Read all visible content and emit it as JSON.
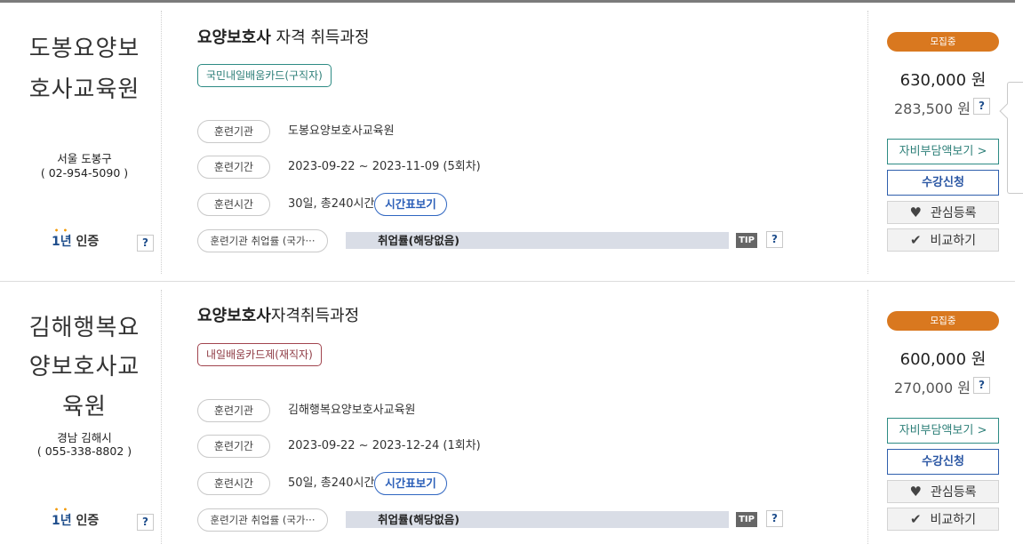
{
  "courses": [
    {
      "institution": {
        "name_line1": "도봉요양보",
        "name_line2": "호사교육원",
        "name_line3": "",
        "region": "서울 도봉구",
        "phone": "( 02-954-5090 )"
      },
      "certification": {
        "years": "1년",
        "label": "인증"
      },
      "title": {
        "bold": "요양보호사",
        "rest": " 자격 취득과정"
      },
      "card_tag": "국민내일배움카드(구직자)",
      "rows": [
        {
          "label": "훈련기관",
          "value": "도봉요양보호사교육원"
        },
        {
          "label": "훈련기간",
          "value": "2023-09-22 ~ 2023-11-09 (5회차)"
        },
        {
          "label": "훈련시간",
          "value": "30일, 총240시간"
        }
      ],
      "time_button": "시간표보기",
      "employment": {
        "label": "훈련기관 취업률 (국가···",
        "bar_text": "취업률(해당없음)",
        "tip": "TIP"
      },
      "status": "모집중",
      "price": "630,000 원",
      "self_pay": "283,500 원",
      "buttons": {
        "self_pay_view": "자비부담액보기 >",
        "apply": "수강신청",
        "wishlist": "관심등록",
        "compare": "비교하기"
      },
      "help": "?"
    },
    {
      "institution": {
        "name_line1": "김해행복요",
        "name_line2": "양보호사교",
        "name_line3": "육원",
        "region": "경남 김해시",
        "phone": "( 055-338-8802 )"
      },
      "certification": {
        "years": "1년",
        "label": "인증"
      },
      "title": {
        "bold": "요양보호사",
        "rest": "자격취득과정"
      },
      "card_tag": "내일배움카드제(재직자)",
      "rows": [
        {
          "label": "훈련기관",
          "value": "김해행복요양보호사교육원"
        },
        {
          "label": "훈련기간",
          "value": "2023-09-22 ~ 2023-12-24 (1회차)"
        },
        {
          "label": "훈련시간",
          "value": "50일, 총240시간"
        }
      ],
      "time_button": "시간표보기",
      "employment": {
        "label": "훈련기관 취업률 (국가···",
        "bar_text": "취업률(해당없음)",
        "tip": "TIP"
      },
      "status": "모집중",
      "price": "600,000 원",
      "self_pay": "270,000 원",
      "buttons": {
        "self_pay_view": "자비부담액보기 >",
        "apply": "수강신청",
        "wishlist": "관심등록",
        "compare": "비교하기"
      },
      "help": "?"
    }
  ],
  "icons": {
    "heart": "heart-icon",
    "check": "check-icon"
  },
  "colors": {
    "status": "#d9781f",
    "teal": "#2d8b84",
    "blue": "#2f5fad",
    "red_tag": "#a1444e",
    "cert_blue": "#1f4e8c",
    "cert_dot": "#f39800"
  }
}
